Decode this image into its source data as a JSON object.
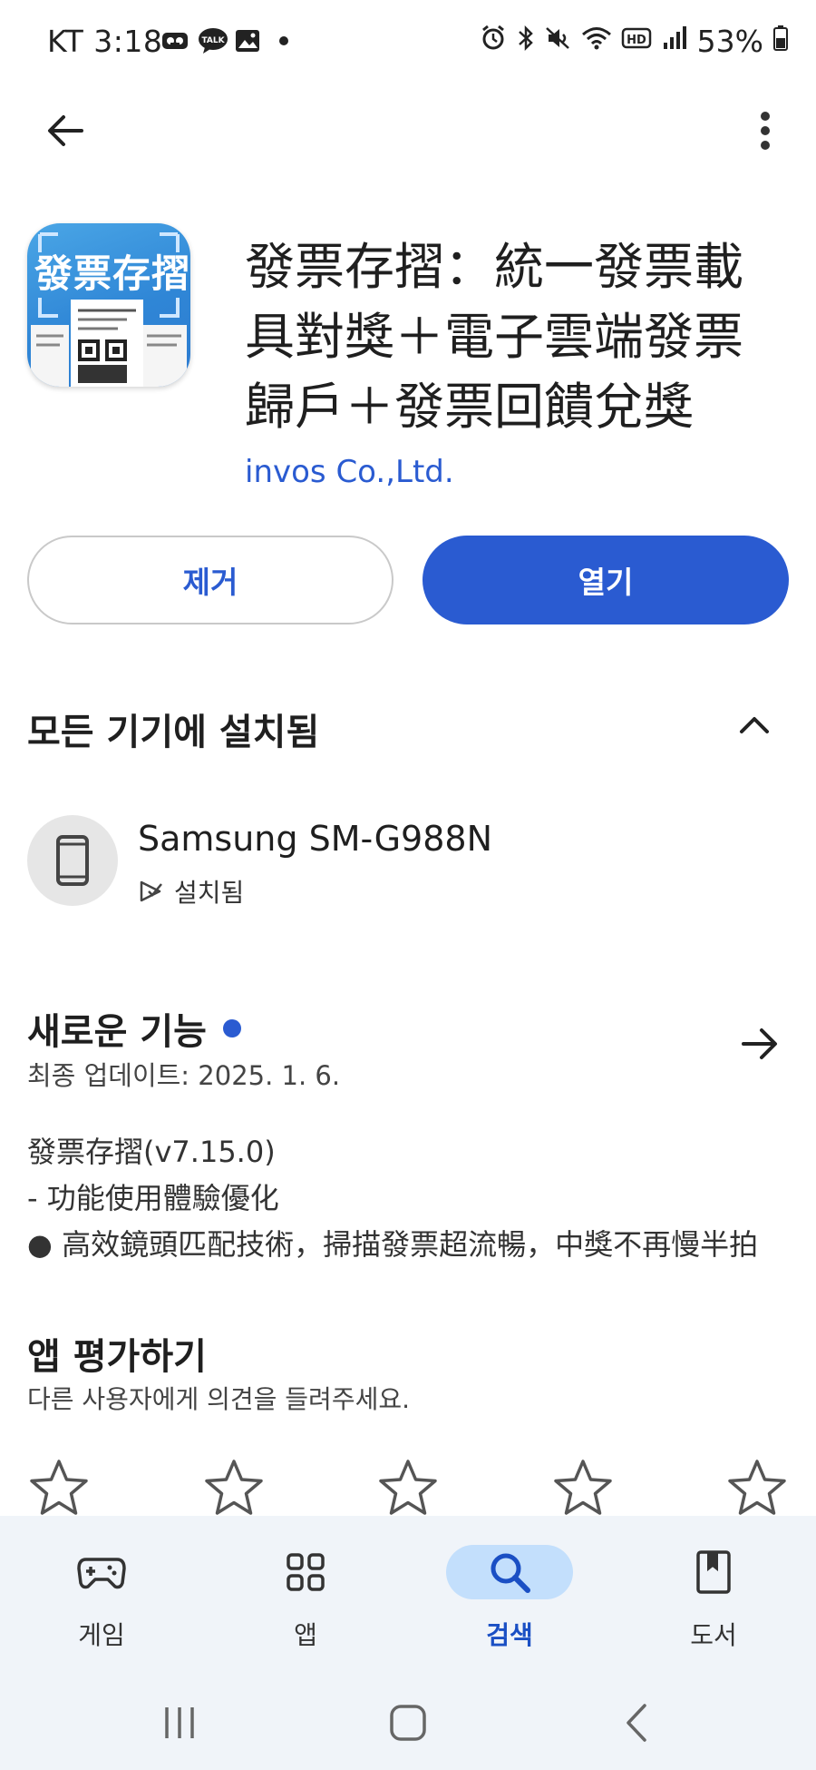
{
  "status_bar": {
    "carrier_time": "KT 3:18",
    "battery": "53%",
    "left_icons": [
      "voicemail-icon",
      "kakaotalk-icon",
      "gallery-icon",
      "dot-icon"
    ],
    "right_icons": [
      "alarm-icon",
      "bluetooth-icon",
      "mute-icon",
      "wifi-icon",
      "hd-icon",
      "signal-icon",
      "battery-icon"
    ]
  },
  "app": {
    "icon_text": "發票存摺",
    "title": "發票存摺：統一發票載具對獎＋電子雲端發票歸戶＋發票回饋兌獎",
    "developer": "invos Co.,Ltd."
  },
  "actions": {
    "uninstall": "제거",
    "open": "열기"
  },
  "installed": {
    "title": "모든 기기에 설치됨",
    "device_name": "Samsung SM-G988N",
    "device_status": "설치됨"
  },
  "whats_new": {
    "title": "새로운 기능",
    "last_update": "최종 업데이트: 2025. 1. 6.",
    "notes": [
      "發票存摺(v7.15.0)",
      "- 功能使用體驗優化",
      "● 高效鏡頭匹配技術，掃描發票超流暢，中獎不再慢半拍"
    ]
  },
  "rate": {
    "title": "앱 평가하기",
    "subtitle": "다른 사용자에게 의견을 들려주세요.",
    "stars": 5,
    "rating": 0
  },
  "bottom_nav": {
    "items": [
      {
        "label": "게임",
        "icon": "gamepad-icon"
      },
      {
        "label": "앱",
        "icon": "apps-grid-icon"
      },
      {
        "label": "검색",
        "icon": "search-icon"
      },
      {
        "label": "도서",
        "icon": "book-icon"
      }
    ],
    "active": "검색"
  },
  "colors": {
    "accent": "#2a5bd1",
    "nav_bg": "#f0f4f9",
    "nav_active_pill": "#c3dffc"
  }
}
